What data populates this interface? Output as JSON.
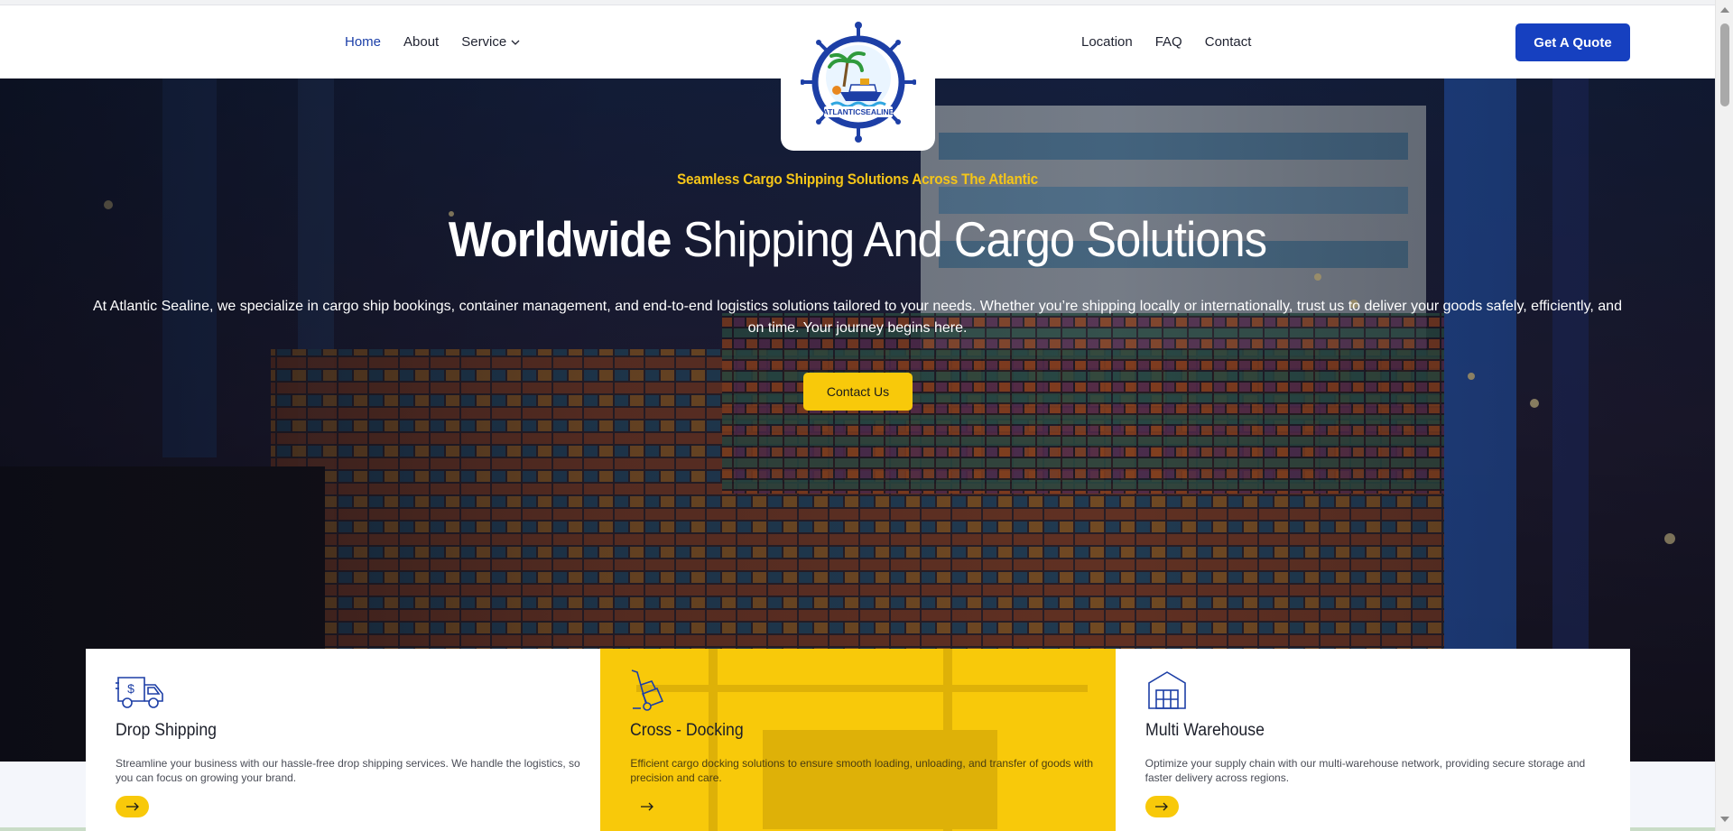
{
  "brand": {
    "logo_text": "ATLANTICSEALINE",
    "primary_color": "#1640c0",
    "accent_color": "#f8c90a"
  },
  "nav": {
    "left": [
      {
        "label": "Home",
        "active": true
      },
      {
        "label": "About"
      },
      {
        "label": "Service",
        "has_dropdown": true
      }
    ],
    "right": [
      {
        "label": "Location"
      },
      {
        "label": "FAQ"
      },
      {
        "label": "Contact"
      }
    ],
    "cta_label": "Get A Quote"
  },
  "hero": {
    "tagline": "Seamless Cargo Shipping Solutions Across The Atlantic",
    "title_bold": "Worldwide",
    "title_rest": " Shipping And Cargo Solutions",
    "description": "At Atlantic Sealine, we specialize in cargo ship bookings, container management, and end-to-end logistics solutions tailored to your needs. Whether you’re shipping locally or internationally, trust us to deliver your goods safely, efficiently, and on time. Your journey begins here.",
    "button_label": "Contact Us"
  },
  "services": [
    {
      "icon": "delivery-van-icon",
      "title": "Drop Shipping",
      "description": "Streamline your business with our hassle-free drop shipping services. We handle the logistics, so you can focus on growing your brand."
    },
    {
      "icon": "hand-truck-icon",
      "title": "Cross - Docking",
      "description": "Efficient cargo docking solutions to ensure smooth loading, unloading, and transfer of goods with precision and care.",
      "featured": true
    },
    {
      "icon": "warehouse-icon",
      "title": "Multi Warehouse",
      "description": "Optimize your supply chain with our multi-warehouse network, providing secure storage and faster delivery across regions."
    }
  ]
}
